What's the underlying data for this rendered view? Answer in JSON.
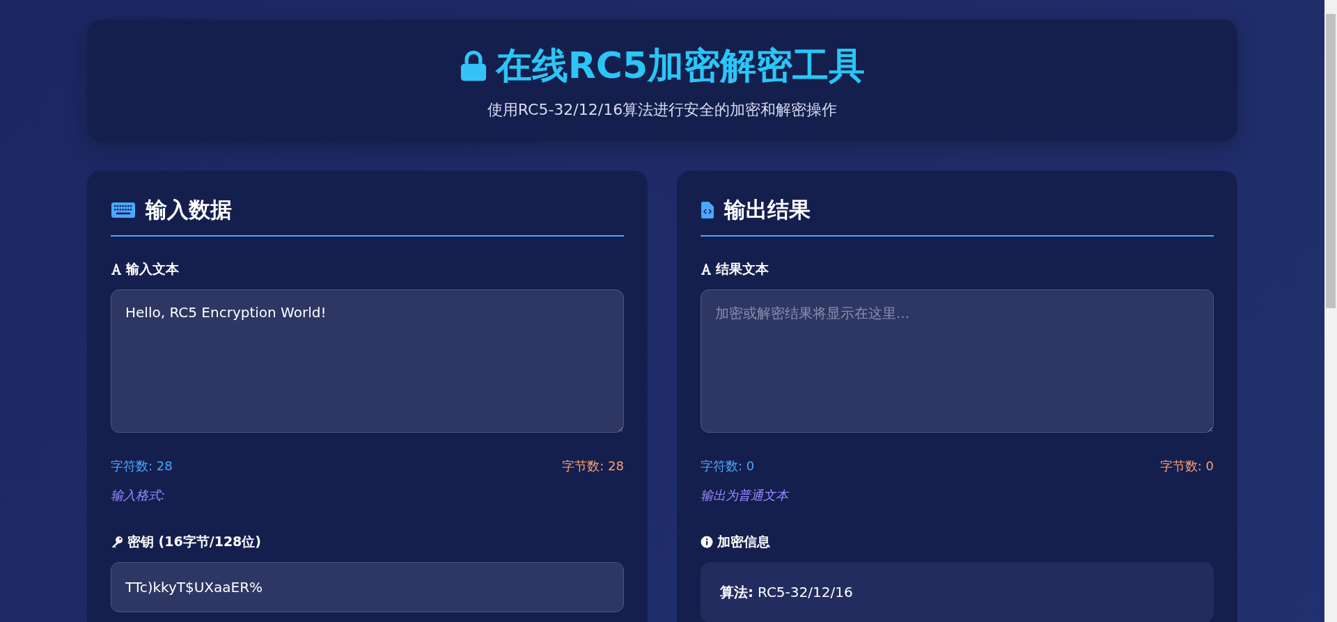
{
  "header": {
    "title": "在线RC5加密解密工具",
    "subtitle": "使用RC5-32/12/16算法进行安全的加密和解密操作"
  },
  "input_panel": {
    "title": "输入数据",
    "text_field": {
      "label": "输入文本",
      "value": "Hello, RC5 Encryption World!"
    },
    "char_count": "字符数: 28",
    "byte_count": "字节数: 28",
    "format_note": "输入格式:",
    "key_field": {
      "label": "密钥 (16字节/128位)",
      "value": "TTc)kkyT$UXaaER%"
    }
  },
  "output_panel": {
    "title": "输出结果",
    "text_field": {
      "label": "结果文本",
      "placeholder": "加密或解密结果将显示在这里..."
    },
    "char_count": "字符数: 0",
    "byte_count": "字节数: 0",
    "format_note": "输出为普通文本",
    "info": {
      "label": "加密信息",
      "rows": [
        {
          "label": "算法:",
          "value": "RC5-32/12/16"
        }
      ]
    }
  }
}
